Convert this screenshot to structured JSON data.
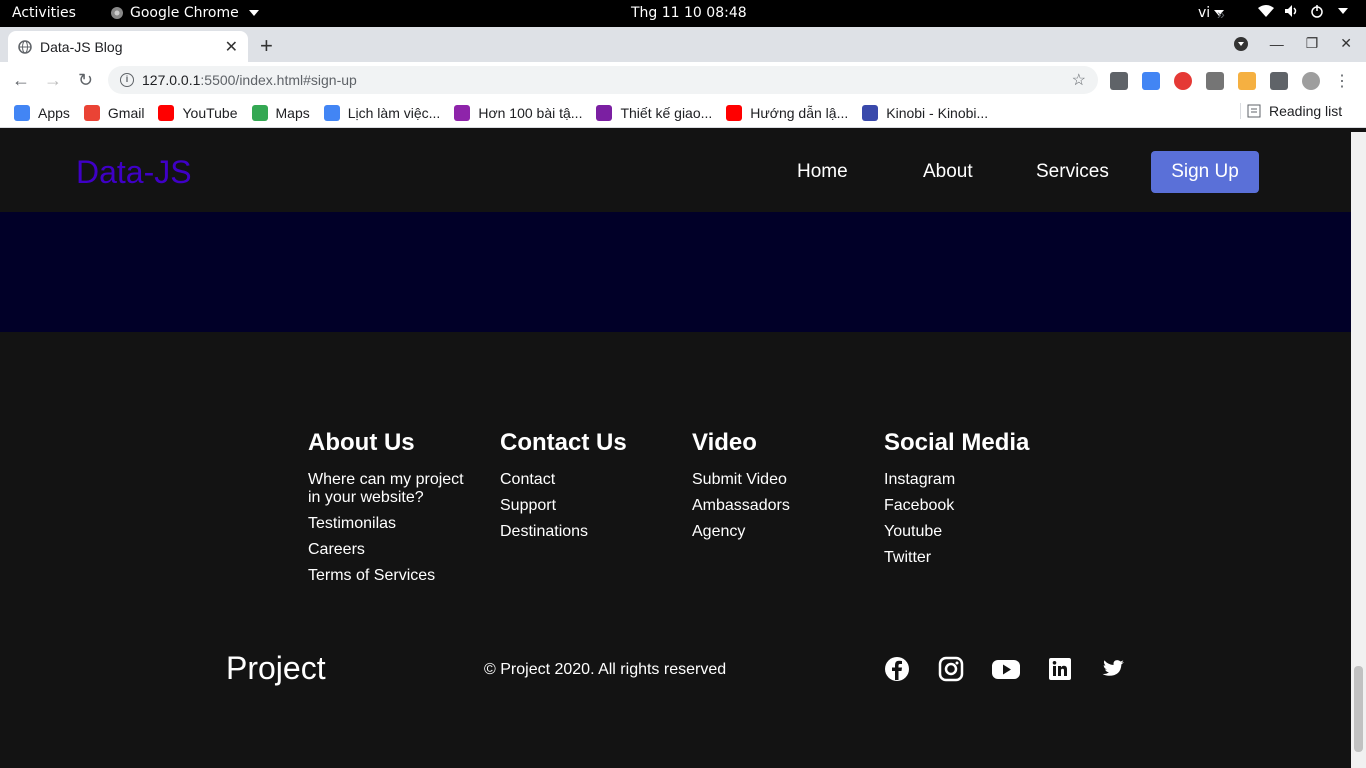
{
  "system_bar": {
    "activities": "Activities",
    "app_name": "Google Chrome",
    "clock": "Thg 11 10  08:48",
    "language": "vi"
  },
  "browser": {
    "tab_title": "Data-JS Blog",
    "url_host": "127.0.0.1",
    "url_path": ":5500/index.html#sign-up",
    "bookmarks": [
      {
        "label": "Apps",
        "icon": "apps-grid-icon",
        "color": "#4285f4"
      },
      {
        "label": "Gmail",
        "icon": "gmail-icon",
        "color": "#ea4335"
      },
      {
        "label": "YouTube",
        "icon": "youtube-icon",
        "color": "#ff0000"
      },
      {
        "label": "Maps",
        "icon": "maps-icon",
        "color": "#34a853"
      },
      {
        "label": "Lịch làm việc...",
        "icon": "calendar-icon",
        "color": "#4285f4"
      },
      {
        "label": "Hơn 100 bài tậ...",
        "icon": "at-sign-icon",
        "color": "#8e24aa"
      },
      {
        "label": "Thiết kế giao...",
        "icon": "lambda-icon",
        "color": "#7b1fa2"
      },
      {
        "label": "Hướng dẫn lậ...",
        "icon": "youtube-icon",
        "color": "#ff0000"
      },
      {
        "label": "Kinobi - Kinobi...",
        "icon": "kinobi-icon",
        "color": "#3949ab"
      }
    ],
    "more_bookmarks": "»",
    "reading_list": "Reading list"
  },
  "page": {
    "logo": "Data-JS",
    "nav": {
      "home": "Home",
      "about": "About",
      "services": "Services",
      "signup": "Sign Up"
    },
    "footer_columns": [
      {
        "heading": "About Us",
        "links": [
          "Where can my project in your website?",
          "Testimonilas",
          "Careers",
          "Terms of Services"
        ]
      },
      {
        "heading": "Contact Us",
        "links": [
          "Contact",
          "Support",
          "Destinations"
        ]
      },
      {
        "heading": "Video",
        "links": [
          "Submit Video",
          "Ambassadors",
          "Agency"
        ]
      },
      {
        "heading": "Social Media",
        "links": [
          "Instagram",
          "Facebook",
          "Youtube",
          "Twitter"
        ]
      }
    ],
    "brand": "Project",
    "copyright": "© Project 2020. All rights reserved",
    "social_icons": [
      "facebook-icon",
      "instagram-icon",
      "youtube-icon",
      "linkedin-icon",
      "twitter-icon"
    ],
    "colors": {
      "logo": "#3f00c6",
      "signup_bg": "#5a70d8",
      "hero_bg": "#010028",
      "page_bg": "#131313"
    }
  }
}
